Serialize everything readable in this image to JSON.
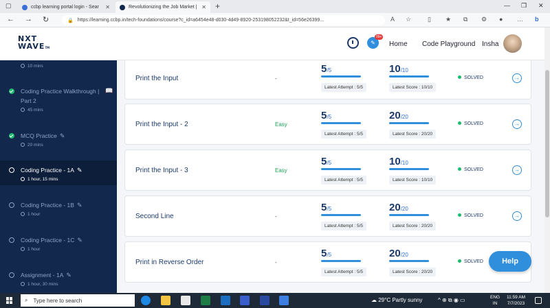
{
  "browser": {
    "tabs": [
      {
        "title": "ccbp learning portal login - Sear",
        "favicon_color": "#3b6fd6"
      },
      {
        "title": "Revolutionizing the Job Market |",
        "favicon_color": "#12284c"
      }
    ],
    "new_tab": "+",
    "url": "https://learning.ccbp.in/tech-foundations/course?c_id=a6454e48-d030-4d49-8920-253198052232&t_id=56e26399..."
  },
  "header": {
    "logo_line1": "NXT",
    "logo_line2": "WAVE",
    "logo_tm": "TM",
    "badge": "99+",
    "links": {
      "home": "Home",
      "playground": "Code Playground",
      "user": "Insha"
    }
  },
  "sidebar": {
    "items": [
      {
        "title": "",
        "meta": "10 mins",
        "state": "done"
      },
      {
        "title": "Coding Practice Walkthrough | Part 2",
        "meta": "45 mins",
        "state": "done"
      },
      {
        "title": "MCQ Practice",
        "meta": "20 mins",
        "state": "done"
      },
      {
        "title": "Coding Practice - 1A",
        "meta": "1 hour, 15 mins",
        "state": "current"
      },
      {
        "title": "Coding Practice - 1B",
        "meta": "1 hour",
        "state": "todo"
      },
      {
        "title": "Coding Practice - 1C",
        "meta": "1 hour",
        "state": "todo"
      },
      {
        "title": "Assignment - 1A",
        "meta": "1 hour, 30 mins",
        "state": "todo"
      }
    ]
  },
  "questions": [
    {
      "title": "Print the Input",
      "difficulty": "-",
      "attempt": "5",
      "attempt_max": "/5",
      "attempt_label": "Latest Attempt : 5/5",
      "score": "10",
      "score_max": "/10",
      "score_label": "Latest Score : 10/10",
      "status": "SOLVED"
    },
    {
      "title": "Print the Input - 2",
      "difficulty": "Easy",
      "attempt": "5",
      "attempt_max": "/5",
      "attempt_label": "Latest Attempt : 5/5",
      "score": "20",
      "score_max": "/20",
      "score_label": "Latest Score : 20/20",
      "status": "SOLVED"
    },
    {
      "title": "Print the Input - 3",
      "difficulty": "Easy",
      "attempt": "5",
      "attempt_max": "/5",
      "attempt_label": "Latest Attempt : 5/5",
      "score": "10",
      "score_max": "/10",
      "score_label": "Latest Score : 10/10",
      "status": "SOLVED"
    },
    {
      "title": "Second Line",
      "difficulty": "-",
      "attempt": "5",
      "attempt_max": "/5",
      "attempt_label": "Latest Attempt : 5/5",
      "score": "20",
      "score_max": "/20",
      "score_label": "Latest Score : 20/20",
      "status": "SOLVED"
    },
    {
      "title": "Print in Reverse Order",
      "difficulty": "-",
      "attempt": "5",
      "attempt_max": "/5",
      "attempt_label": "Latest Attempt : 5/5",
      "score": "20",
      "score_max": "/20",
      "score_label": "Latest Score : 20/20",
      "status": "SOLVED"
    }
  ],
  "help": "Help",
  "taskbar": {
    "search_placeholder": "Type here to search",
    "weather": "29°C  Partly sunny",
    "lang1": "ENG",
    "lang2": "IN",
    "time": "11:59 AM",
    "date": "7/7/2023"
  },
  "colors": {
    "accent": "#2f8fdd",
    "sidebar": "#12284c",
    "solved": "#1cbb6e",
    "easy": "#1ea05a"
  }
}
